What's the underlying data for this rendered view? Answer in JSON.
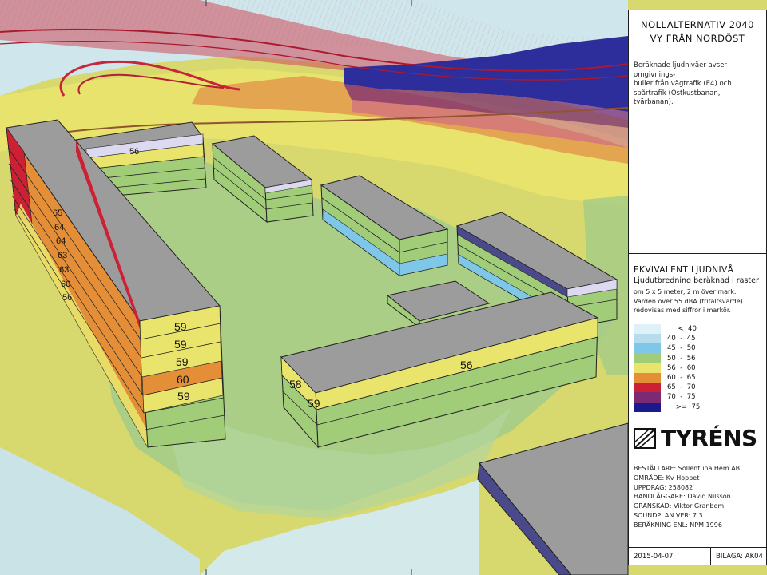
{
  "panel": {
    "title_line1": "NOLLALTERNATIV 2040",
    "title_line2": "VY FRÅN NORDÖST",
    "desc_line1": "Beräknade ljudnivåer avser omgivnings-",
    "desc_line2": "buller från vägtrafik (E4) och",
    "desc_line3": "spårtrafik (Ostkustbanan, tvärbanan).",
    "heading": "EKVIVALENT LJUDNIVÅ",
    "subheading": "Ljudutbredning beräknad i raster",
    "note_line1": "om 5 x 5 meter, 2 m över mark.",
    "note_line2": "Värden över 55 dBA (frifältsvärde)",
    "note_line3": "redovisas med siffror i markör."
  },
  "legend": [
    {
      "label": "     <  40",
      "color": "#dff1f8"
    },
    {
      "label": "40  -  45",
      "color": "#b7dced"
    },
    {
      "label": "45  -  50",
      "color": "#7ec7e8"
    },
    {
      "label": "50  -  56",
      "color": "#a1cd79"
    },
    {
      "label": "56  -  60",
      "color": "#e9e46b"
    },
    {
      "label": "60  -  65",
      "color": "#e48f37"
    },
    {
      "label": "65  -  70",
      "color": "#cc2035"
    },
    {
      "label": "70  -  75",
      "color": "#7b2a73"
    },
    {
      "label": "    >=  75",
      "color": "#1a1a8c"
    }
  ],
  "logo": {
    "text": "TYRÉNS",
    "icon": "tyrens-logo-icon"
  },
  "meta": {
    "bestallare": "BESTÄLLARE: Sollentuna Hem AB",
    "omrade": "OMRÅDE: Kv Hoppet",
    "uppdrag": "UPPDRAG: 258082",
    "handlaggare": "HANDLÄGGARE: David Nilsson",
    "granskad": "GRANSKAD: Viktor Granbom",
    "soundplan": "SOUNDPLAN VER: 7.3",
    "berakning": "BERÄKNING ENL: NPM 1996"
  },
  "footer": {
    "date": "2015-04-07",
    "bilaga": "BILAGA: AK04"
  },
  "facade": {
    "w_left": [
      "65",
      "64",
      "64",
      "63",
      "63",
      "60",
      "56"
    ],
    "w_front": [
      "59",
      "59",
      "59",
      "60",
      "59"
    ],
    "n_top": "56",
    "s_main": "56",
    "s_end_top": "58",
    "s_end_bot": "59"
  },
  "colors": {
    "lt40": "#dff1f8",
    "d40_45": "#b7dced",
    "d45_50": "#7ec7e8",
    "d50_56": "#a1cd79",
    "d56_60": "#e9e46b",
    "d60_65": "#e48f37",
    "d65_70": "#cc2035",
    "d70_75": "#7b2a73",
    "gte75": "#1a1a8c",
    "roof": "#9c9c9c"
  }
}
